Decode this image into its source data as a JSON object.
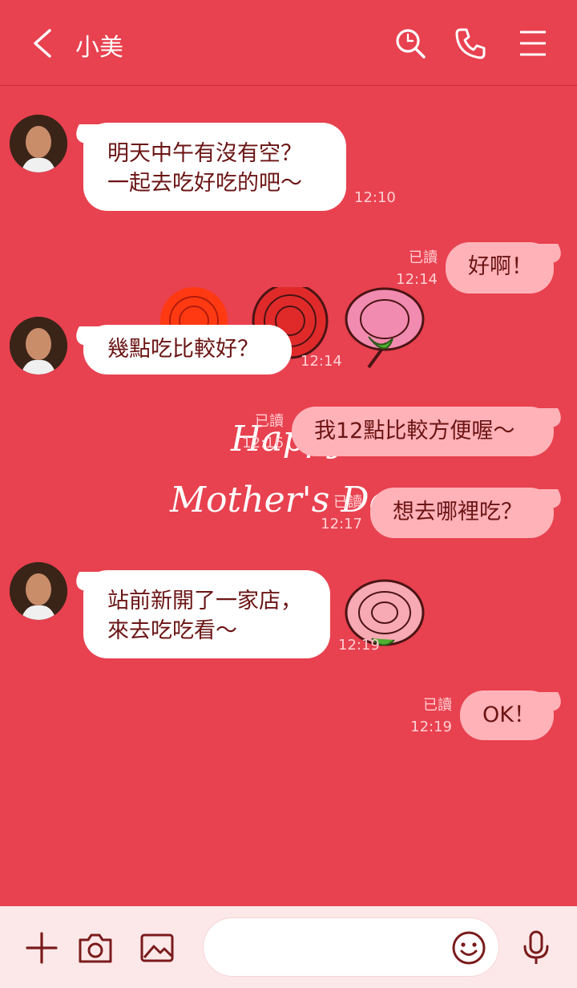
{
  "header": {
    "title": "小美"
  },
  "decoration": {
    "line1": "Happy",
    "line2": "Mother's Day"
  },
  "messages": [
    {
      "text": "明天中午有沒有空？\n一起去吃好吃的吧～",
      "time": "12:10"
    },
    {
      "text": "好啊！",
      "read": "已讀",
      "time": "12:14"
    },
    {
      "text": "幾點吃比較好？",
      "time": "12:14"
    },
    {
      "text": "我12點比較方便喔～",
      "read": "已讀",
      "time": "12:16"
    },
    {
      "text": "想去哪裡吃？",
      "read": "已讀",
      "time": "12:17"
    },
    {
      "text": "站前新開了一家店，\n來去吃吃看～",
      "time": "12:19"
    },
    {
      "text": "OK！",
      "read": "已讀",
      "time": "12:19"
    }
  ],
  "composer": {
    "placeholder": ""
  },
  "colors": {
    "background": "#e8414f",
    "bubble_out": "#ffb2b8",
    "bottom_bar": "#fde8e9",
    "icon": "#7a1b1b"
  }
}
